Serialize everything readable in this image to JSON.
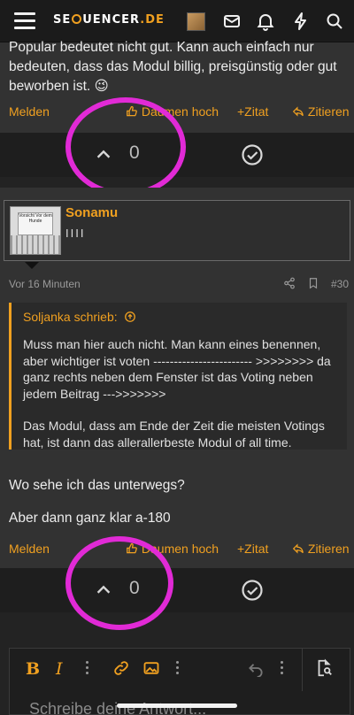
{
  "header": {
    "logo_text": "SEQUENCER",
    "logo_o": "",
    "logo_part1": "SE",
    "logo_part2": "UENCER",
    "logo_domain": ".DE"
  },
  "post1": {
    "text": "Popular bedeutet nicht gut. Kann auch einfach nur bedeuten, dass das Modul billig, preisgünstig oder gut beworben ist. 😉",
    "actions": {
      "report": "Melden",
      "like": "Daumen hoch",
      "quote": "+Zitat",
      "reply": "Zitieren"
    },
    "votes": "0"
  },
  "post2": {
    "username": "Sonamu",
    "user_title": "IIII",
    "avatar_sign": "Vorsicht Vor dem Hunde",
    "time": "Vor 16 Minuten",
    "number": "#30",
    "quote": {
      "author": "Soljanka schrieb:",
      "paragraph1": "Muss man hier auch nicht. Man kann eines benennen, aber wichtiger ist voten ------------------------ >>>>>>>> da ganz rechts neben dem Fenster ist das Voting neben jedem Beitrag --->>>>>>>",
      "paragraph2": "Das Modul, dass am Ende der Zeit die meisten Votings hat, ist dann das allerallerbeste Modul of all time."
    },
    "line1": "Wo sehe ich das unterwegs?",
    "line2": "Aber dann ganz klar a-180",
    "actions": {
      "report": "Melden",
      "like": "Daumen hoch",
      "quote": "+Zitat",
      "reply": "Zitieren"
    },
    "votes": "0"
  },
  "editor": {
    "bold": "B",
    "italic": "I",
    "placeholder": "Schreibe deine Antwort..."
  },
  "colors": {
    "accent": "#f0a020",
    "annotation": "#e12ad6",
    "background": "#323232"
  }
}
